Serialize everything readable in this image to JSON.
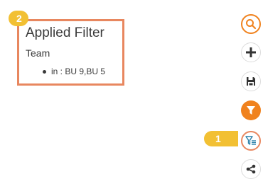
{
  "applied_filter": {
    "title": "Applied Filter",
    "field": "Team",
    "value": "in : BU 9,BU 5"
  },
  "callouts": {
    "step_2": "2",
    "step_1": "1"
  },
  "toolbar": {
    "items": [
      {
        "icon": "search-icon",
        "active": true
      },
      {
        "icon": "plus-icon",
        "active": false
      },
      {
        "icon": "save-icon",
        "active": false
      },
      {
        "icon": "filter-icon",
        "active": true
      },
      {
        "icon": "applied-filter-icon",
        "active": true
      },
      {
        "icon": "share-icon",
        "active": false
      }
    ]
  },
  "colors": {
    "accent": "#f0821e",
    "highlight_border": "#e8875f",
    "callout": "#f2c033",
    "icon_dark": "#333333"
  }
}
